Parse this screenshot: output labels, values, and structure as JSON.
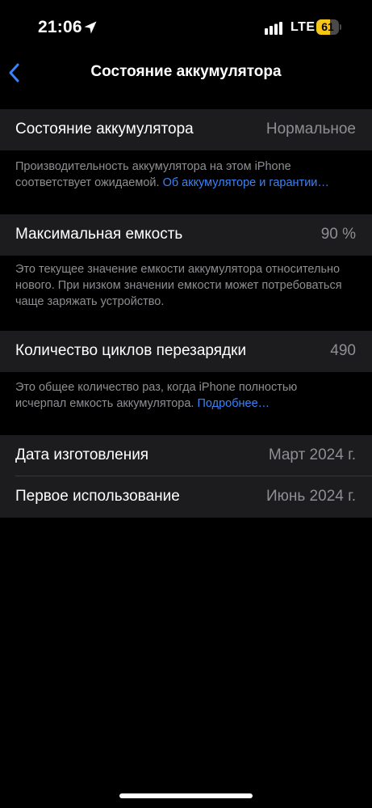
{
  "status_bar": {
    "time": "21:06",
    "network": "LTE",
    "battery_level": "61",
    "battery_fraction": 0.61,
    "location_icon": "location-arrow-icon",
    "signal_icon": "signal-bars-icon",
    "battery_icon": "battery-icon"
  },
  "nav": {
    "title": "Состояние аккумулятора",
    "back_icon": "chevron-left-icon"
  },
  "battery_health": {
    "label": "Состояние аккумулятора",
    "value": "Нормальное",
    "footnote": "Производительность аккумулятора на этом iPhone соответствует ожидаемой.",
    "footnote_link": "Об аккумуляторе и гарантии…"
  },
  "max_capacity": {
    "label": "Максимальная емкость",
    "value": "90 %",
    "footnote": "Это текущее значение емкости аккумулятора относительно нового. При низком значении емкости может потребоваться чаще заряжать устройство."
  },
  "cycle_count": {
    "label": "Количество циклов перезарядки",
    "value": "490",
    "footnote": "Это общее количество раз, когда iPhone полностью исчерпал емкость аккумулятора.",
    "footnote_link": "Подробнее…"
  },
  "dates": {
    "manufacture_label": "Дата изготовления",
    "manufacture_value": "Март 2024 г.",
    "first_use_label": "Первое использование",
    "first_use_value": "Июнь 2024 г."
  },
  "colors": {
    "background": "#000000",
    "cell_background": "#1c1c1e",
    "secondary_text": "#8e8e93",
    "link": "#3a82f7",
    "battery_yellow": "#f5c518"
  }
}
